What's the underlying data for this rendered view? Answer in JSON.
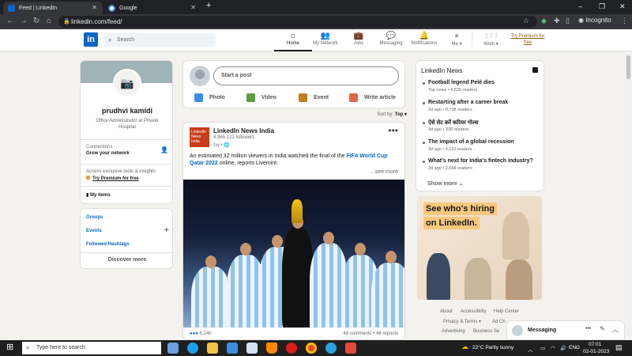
{
  "browser": {
    "tabs": [
      {
        "title": "Feed | LinkedIn",
        "favicon_color": "#0a66c2"
      },
      {
        "title": "Google",
        "favicon_color": "#4285f4"
      }
    ],
    "new_tab": "+",
    "url": "linkedin.com/feed/",
    "profile_label": "Incognito",
    "window_controls": [
      "–",
      "❐",
      "✕"
    ]
  },
  "nav": {
    "logo": "in",
    "search_placeholder": "Search",
    "items": [
      {
        "label": "Home",
        "icon": "⌂"
      },
      {
        "label": "My Network",
        "icon": "👥"
      },
      {
        "label": "Jobs",
        "icon": "💼"
      },
      {
        "label": "Messaging",
        "icon": "💬"
      },
      {
        "label": "Notifications",
        "icon": "🔔"
      },
      {
        "label": "Me ▾",
        "icon": "●"
      },
      {
        "label": "Work ▾",
        "icon": "⋮⋮⋮"
      }
    ],
    "premium": "Try Premium for free"
  },
  "profile": {
    "name": "prudhvi kamidi",
    "title": "Office Administrator at Private Hospital",
    "connections_label": "Connections",
    "grow_label": "Grow your network",
    "premium_text": "Access exclusive tools & insights",
    "premium_link": "Try Premium for free",
    "my_items": "My items"
  },
  "left_links": {
    "groups": "Groups",
    "events": "Events",
    "hashtags": "Followed Hashtags",
    "discover": "Discover more",
    "add": "+"
  },
  "composer": {
    "placeholder": "Start a post",
    "actions": [
      {
        "label": "Photo",
        "color": "#378fe9"
      },
      {
        "label": "Video",
        "color": "#5f9b41"
      },
      {
        "label": "Event",
        "color": "#c37d16"
      },
      {
        "label": "Write article",
        "color": "#e16745"
      }
    ]
  },
  "sort": {
    "label": "Sort by:",
    "value": "Top ▾"
  },
  "post": {
    "author": "LinkedIn News India",
    "followers": "4,965,121 followers",
    "time": "1w • 🌐",
    "logo_text": "LinkedIn News India",
    "text_before": "An estimated 32 million viewers in India watched the final of the ",
    "highlight": "FIFA World Cup Qatar 2022",
    "text_after": " online, reports Livemint.",
    "see_more": "...see more",
    "reactions": "6,240",
    "comments": "48 comments • 46 reposts",
    "menu": "•••"
  },
  "news": {
    "title": "LinkedIn News",
    "items": [
      {
        "headline": "Football legend Pelé dies",
        "meta": "Top news • 4,526 readers"
      },
      {
        "headline": "Restarting after a career break",
        "meta": "2d ago • 8,708 readers"
      },
      {
        "headline": "ऐसे सेट करें करियर गोल्स",
        "meta": "9d ago • 338 readers"
      },
      {
        "headline": "The impact of a global recession",
        "meta": "3d ago • 5,110 readers"
      },
      {
        "headline": "What's next for India's fintech industry?",
        "meta": "3d ago • 2,698 readers"
      }
    ],
    "show_more": "Show more ⌄"
  },
  "ad": {
    "line1": "See who's hiring",
    "line2": "on LinkedIn."
  },
  "footer": {
    "about": "About",
    "accessibility": "Accessibility",
    "help": "Help Center",
    "privacy": "Privacy & Terms ▾",
    "adchoices": "Ad Ch",
    "advertising": "Advertising",
    "business": "Business Se"
  },
  "messaging": {
    "label": "Messaging",
    "more": "•••",
    "compose": "✎",
    "collapse": "︿"
  },
  "taskbar": {
    "search_placeholder": "Type here to search",
    "weather": "22°C  Partly sunny",
    "lang": "ENG",
    "time": "07:01",
    "date": "02-01-2023"
  }
}
